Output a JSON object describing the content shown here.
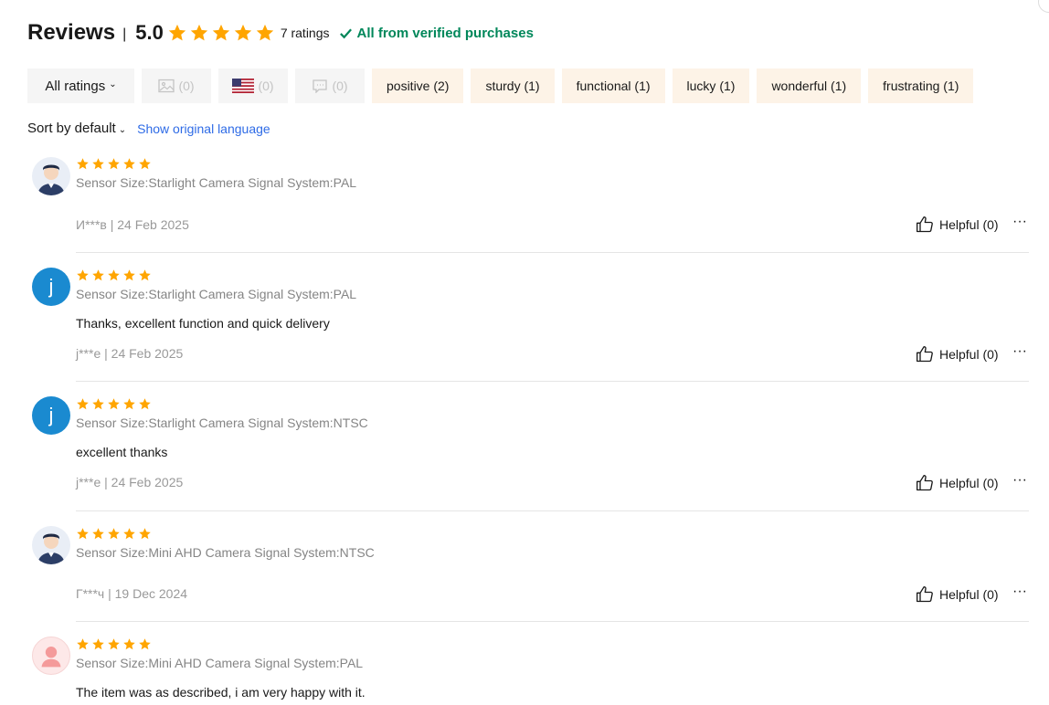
{
  "header": {
    "title": "Reviews",
    "separator": "|",
    "score": "5.0",
    "ratings_count": "7 ratings",
    "verified": "All from verified purchases",
    "accent": "#00875a",
    "star_color": "#ffa500"
  },
  "filters": {
    "all_ratings": "All ratings",
    "photo_count": "(0)",
    "country_count": "(0)",
    "comment_count": "(0)",
    "tags": [
      {
        "label": "positive (2)"
      },
      {
        "label": "sturdy (1)"
      },
      {
        "label": "functional (1)"
      },
      {
        "label": "lucky (1)"
      },
      {
        "label": "wonderful (1)"
      },
      {
        "label": "frustrating (1)"
      }
    ],
    "icons": [
      "image-icon",
      "us-flag-icon",
      "comment-icon"
    ]
  },
  "sort": {
    "label": "Sort by default",
    "show_original": "Show original language"
  },
  "reviews": [
    {
      "avatar": "user-avatar-icon",
      "stars": 5,
      "sku": "Sensor Size:Starlight Camera Signal System:PAL",
      "text": "",
      "meta": "И***в | 24 Feb 2025",
      "helpful": "Helpful (0)"
    },
    {
      "avatar_letter": "j",
      "stars": 5,
      "sku": "Sensor Size:Starlight Camera Signal System:PAL",
      "text": "Thanks, excellent function and quick delivery",
      "meta": "j***e | 24 Feb 2025",
      "helpful": "Helpful (0)"
    },
    {
      "avatar_letter": "j",
      "stars": 5,
      "sku": "Sensor Size:Starlight Camera Signal System:NTSC",
      "text": "excellent thanks",
      "meta": "j***e | 24 Feb 2025",
      "helpful": "Helpful (0)"
    },
    {
      "avatar": "user-avatar-icon",
      "stars": 5,
      "sku": "Sensor Size:Mini AHD Camera Signal System:NTSC",
      "text": "",
      "meta": "Г***ч | 19 Dec 2024",
      "helpful": "Helpful (0)"
    },
    {
      "avatar": "user-avatar-female-icon",
      "stars": 5,
      "sku": "Sensor Size:Mini AHD Camera Signal System:PAL",
      "text": "The item was as described, i am very happy with it.",
      "meta": "",
      "helpful": ""
    }
  ],
  "more_glyph": "···"
}
